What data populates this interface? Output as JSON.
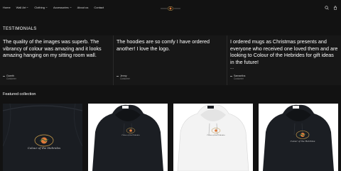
{
  "header": {
    "nav": [
      {
        "label": "Home",
        "dropdown": false
      },
      {
        "label": "Wall Art",
        "dropdown": true
      },
      {
        "label": "Clothing",
        "dropdown": true
      },
      {
        "label": "Accessories",
        "dropdown": true
      },
      {
        "label": "About us",
        "dropdown": false
      },
      {
        "label": "Contact",
        "dropdown": false
      }
    ],
    "icons": [
      "search-icon",
      "cart-icon"
    ]
  },
  "testimonials": {
    "title": "TESTIMONIALS",
    "items": [
      {
        "quote": "The quality of the images was superb. The vibrancy of colour was amazing and it looks amazing hanging on my sitting room wall.",
        "author": "Gareth",
        "role": "Customer",
        "truncated": false
      },
      {
        "quote": "The hoodies are so comfy I have ordered another! I love the logo.",
        "author": "Jenny",
        "role": "Customer",
        "truncated": false
      },
      {
        "quote": "I ordered mugs as Christmas presents and everyone who received one loved them and are looking to Colour of the Hebrides for gift ideas in the future!",
        "author": "Samantha",
        "role": "Customer",
        "truncated": true,
        "ellipsis": "..."
      }
    ]
  },
  "featured": {
    "title": "Featured collection",
    "products": [
      {
        "name": "hoodie-closeup",
        "color": "#1a1d22"
      },
      {
        "name": "hoodie-black",
        "color": "#1b1e23"
      },
      {
        "name": "hoodie-white",
        "color": "#f4f4f4"
      },
      {
        "name": "hoodie-black-alt",
        "color": "#1b1e23"
      }
    ]
  },
  "colors": {
    "background": "#121212",
    "card": "#171717",
    "text": "#ffffff",
    "muted": "#8a8a8a"
  }
}
